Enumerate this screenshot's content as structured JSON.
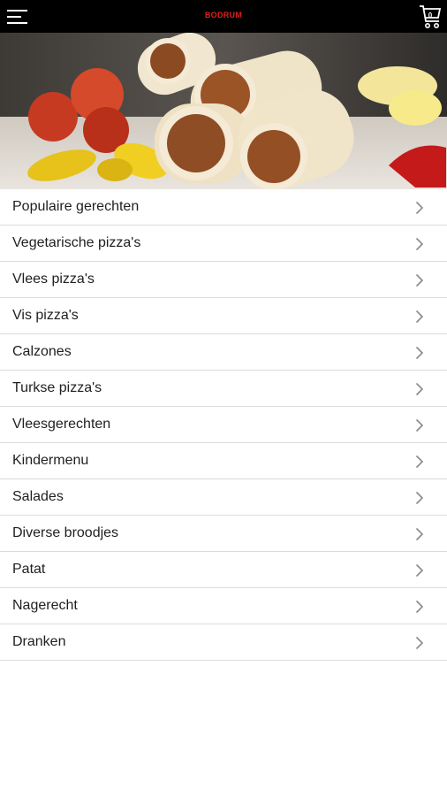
{
  "header": {
    "brand": "BODRUM",
    "cart_count": "0",
    "icons": {
      "menu": "hamburger-menu-icon",
      "cart": "shopping-cart-icon"
    },
    "colors": {
      "bar": "#000000",
      "brand": "#e0201c"
    }
  },
  "hero": {
    "image": "wraps-with-peppers-photo"
  },
  "categories": [
    {
      "label": "Populaire gerechten"
    },
    {
      "label": "Vegetarische pizza's"
    },
    {
      "label": "Vlees pizza's"
    },
    {
      "label": "Vis pizza's"
    },
    {
      "label": "Calzones"
    },
    {
      "label": "Turkse pizza's"
    },
    {
      "label": "Vleesgerechten"
    },
    {
      "label": "Kindermenu"
    },
    {
      "label": "Salades"
    },
    {
      "label": "Diverse broodjes"
    },
    {
      "label": "Patat"
    },
    {
      "label": "Nagerecht"
    },
    {
      "label": "Dranken"
    }
  ]
}
